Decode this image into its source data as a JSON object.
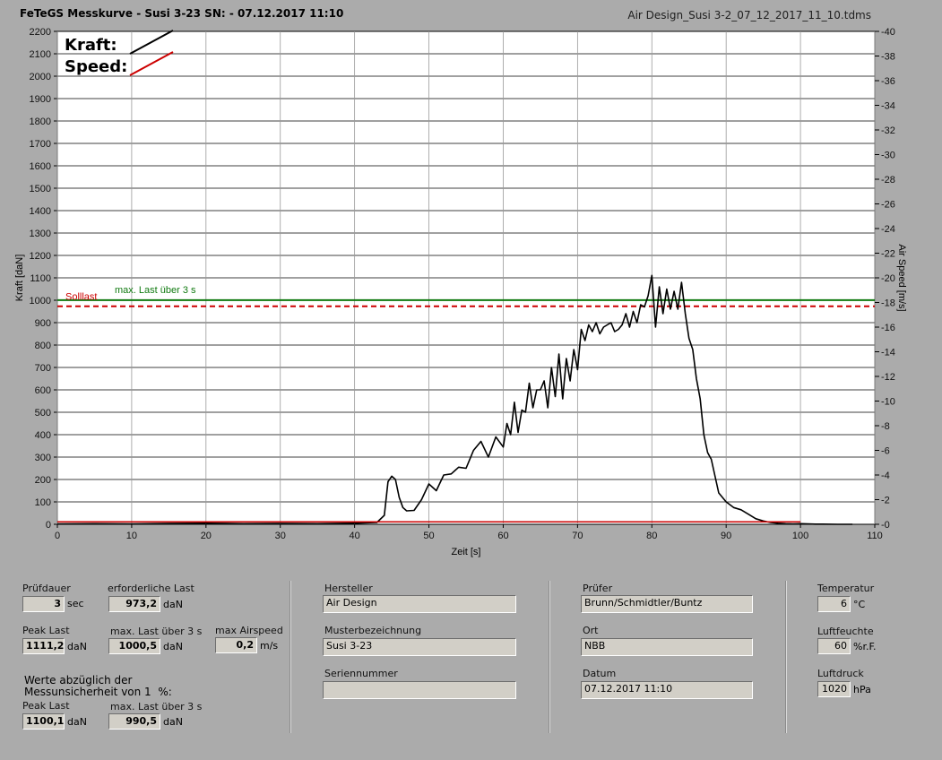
{
  "header": {
    "title": "FeTeGS Messkurve - Susi 3-23  SN:  - 07.12.2017 11:10",
    "filename": "Air Design_Susi 3-2_07_12_2017_11_10.tdms"
  },
  "colors": {
    "kraft": "#000000",
    "speed": "#cc0000",
    "maxlast": "#107a10",
    "solllast": "#cc0000",
    "background": "#ababab",
    "plot": "#ffffff"
  },
  "chart_data": {
    "type": "line",
    "xlabel": "Zeit [s]",
    "ylabel": "Kraft [daN]",
    "y2label": "Air Speed [m/s]",
    "xlim": [
      0,
      110
    ],
    "ylim": [
      0,
      2200
    ],
    "y2lim": [
      0,
      40
    ],
    "x_ticks": [
      "0",
      "10",
      "20",
      "30",
      "40",
      "50",
      "60",
      "70",
      "80",
      "90",
      "100",
      "110"
    ],
    "y_ticks": [
      "0",
      "100",
      "200",
      "300",
      "400",
      "500",
      "600",
      "700",
      "800",
      "900",
      "1000",
      "1100",
      "1200",
      "1300",
      "1400",
      "1500",
      "1600",
      "1700",
      "1800",
      "1900",
      "2000",
      "2100",
      "2200"
    ],
    "y2_ticks": [
      "0",
      "2",
      "4",
      "6",
      "8",
      "10",
      "12",
      "14",
      "16",
      "18",
      "20",
      "22",
      "24",
      "26",
      "28",
      "30",
      "32",
      "34",
      "36",
      "38",
      "40"
    ],
    "legend": {
      "position": "top-left",
      "entries": [
        {
          "label": "Kraft:",
          "color": "#000000"
        },
        {
          "label": "Speed:",
          "color": "#cc0000"
        }
      ]
    },
    "reference_lines": [
      {
        "label": "max. Last über  3 s",
        "value": 1000.5,
        "color": "#107a10",
        "style": "solid"
      },
      {
        "label": "Solllast",
        "value": 973.2,
        "color": "#cc0000",
        "style": "dashed"
      }
    ],
    "series": [
      {
        "name": "Kraft",
        "axis": "left",
        "color": "#000000",
        "x": [
          0,
          5,
          10,
          15,
          20,
          25,
          30,
          35,
          40,
          43,
          44,
          44.5,
          45,
          45.5,
          46,
          46.5,
          47,
          48,
          49,
          50,
          51,
          52,
          53,
          54,
          55,
          56,
          57,
          58,
          59,
          60,
          60.5,
          61,
          61.5,
          62,
          62.5,
          63,
          63.5,
          64,
          64.5,
          65,
          65.5,
          66,
          66.5,
          67,
          67.5,
          68,
          68.5,
          69,
          69.5,
          70,
          70.5,
          71,
          71.5,
          72,
          72.5,
          73,
          73.5,
          74,
          74.5,
          75,
          75.5,
          76,
          76.5,
          77,
          77.5,
          78,
          78.5,
          79,
          79.5,
          80,
          80.5,
          81,
          81.5,
          82,
          82.5,
          83,
          83.5,
          84,
          84.5,
          85,
          85.5,
          86,
          86.5,
          87,
          87.5,
          88,
          89,
          90,
          91,
          92,
          93,
          94,
          95,
          96,
          97,
          98,
          99,
          100,
          101,
          102,
          103,
          105,
          107
        ],
        "values": [
          2,
          3,
          2,
          4,
          5,
          3,
          4,
          3,
          5,
          8,
          40,
          190,
          215,
          200,
          120,
          75,
          60,
          62,
          110,
          180,
          150,
          220,
          225,
          255,
          250,
          330,
          370,
          300,
          390,
          345,
          450,
          400,
          545,
          410,
          510,
          500,
          630,
          520,
          600,
          600,
          640,
          520,
          700,
          570,
          760,
          560,
          740,
          640,
          780,
          690,
          870,
          820,
          890,
          860,
          900,
          850,
          880,
          890,
          900,
          860,
          870,
          890,
          940,
          880,
          950,
          900,
          980,
          970,
          1020,
          1111,
          880,
          1060,
          940,
          1050,
          960,
          1040,
          960,
          1080,
          940,
          830,
          780,
          650,
          560,
          400,
          320,
          290,
          140,
          100,
          75,
          65,
          45,
          25,
          15,
          8,
          5,
          3,
          2,
          3,
          2,
          1,
          1,
          0,
          0
        ]
      },
      {
        "name": "Speed",
        "axis": "right",
        "color": "#cc0000",
        "x": [
          0,
          100
        ],
        "values": [
          0.2,
          0.2
        ]
      }
    ]
  },
  "fields": {
    "pruefdauer": {
      "label": "Prüfdauer",
      "value": "3",
      "unit": "sec"
    },
    "erf_last": {
      "label": "erforderliche Last",
      "value": "973,2",
      "unit": "daN"
    },
    "peak_last": {
      "label": "Peak Last",
      "value": "1111,2",
      "unit": "daN"
    },
    "max_last": {
      "label": "max. Last über  3 s",
      "value": "1000,5",
      "unit": "daN"
    },
    "max_airspeed": {
      "label": "max Airspeed",
      "value": "0,2",
      "unit": "m/s"
    },
    "werte_note": "Werte abzüglich der\nMessunsicherheit von 1  %:",
    "peak_last2": {
      "label": "Peak Last",
      "value": "1100,1",
      "unit": "daN"
    },
    "max_last2": {
      "label": "max. Last über  3 s",
      "value": "990,5",
      "unit": "daN"
    },
    "hersteller": {
      "label": "Hersteller",
      "value": "Air Design"
    },
    "musterbezeichnung": {
      "label": "Musterbezeichnung",
      "value": "Susi 3-23"
    },
    "seriennummer": {
      "label": "Seriennummer",
      "value": ""
    },
    "pruefer": {
      "label": "Prüfer",
      "value": "Brunn/Schmidtler/Buntz"
    },
    "ort": {
      "label": "Ort",
      "value": "NBB"
    },
    "datum": {
      "label": "Datum",
      "value": "07.12.2017 11:10"
    },
    "temperatur": {
      "label": "Temperatur",
      "value": "6",
      "unit": "°C"
    },
    "luftfeuchte": {
      "label": "Luftfeuchte",
      "value": "60",
      "unit": "%r.F."
    },
    "luftdruck": {
      "label": "Luftdruck",
      "value": "1020",
      "unit": "hPa"
    }
  }
}
